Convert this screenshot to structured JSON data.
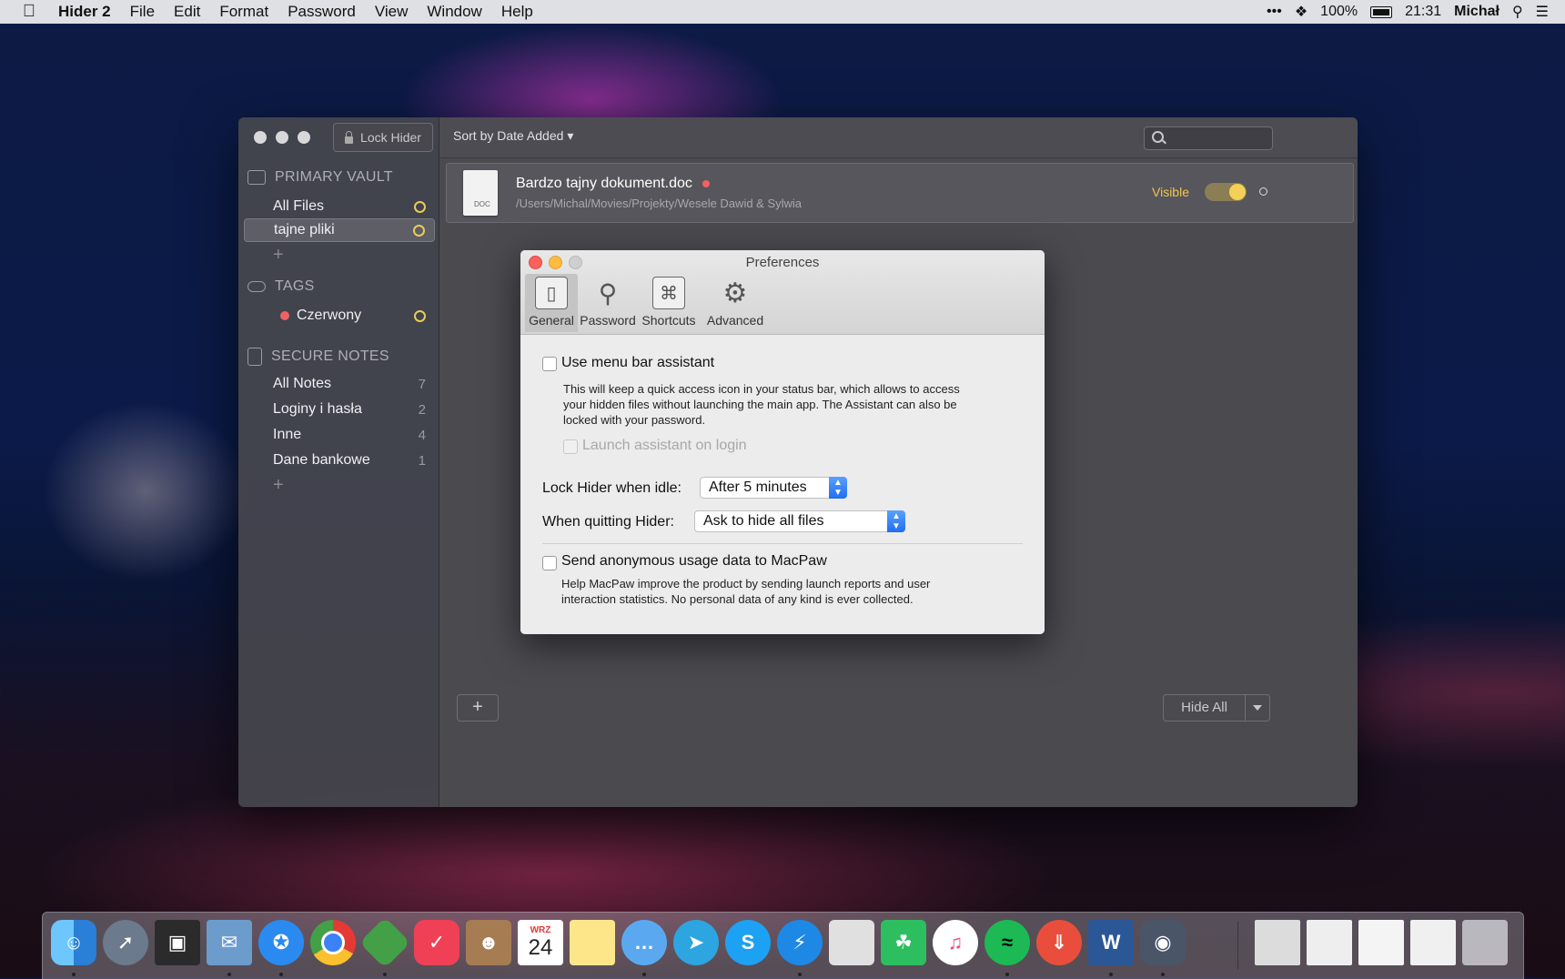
{
  "menubar": {
    "apple_icon": "apple-logo-icon",
    "app_name": "Hider 2",
    "menus": [
      "File",
      "Edit",
      "Format",
      "Password",
      "View",
      "Window",
      "Help"
    ],
    "battery": "100%",
    "time": "21:31",
    "user": "Michał"
  },
  "sidebar": {
    "lock_label": "Lock Hider",
    "primary_vault": {
      "title": "PRIMARY VAULT",
      "items": [
        {
          "label": "All Files"
        },
        {
          "label": "tajne pliki"
        }
      ]
    },
    "tags": {
      "title": "TAGS",
      "items": [
        {
          "label": "Czerwony",
          "color": "#f06262"
        }
      ]
    },
    "secure_notes": {
      "title": "SECURE NOTES",
      "items": [
        {
          "label": "All Notes",
          "count": "7"
        },
        {
          "label": "Loginy i hasła",
          "count": "2"
        },
        {
          "label": "Inne",
          "count": "4"
        },
        {
          "label": "Dane bankowe",
          "count": "1"
        }
      ]
    }
  },
  "toolbar": {
    "sort_label": "Sort by Date Added"
  },
  "file": {
    "name": "Bardzo tajny dokument.doc",
    "path": "/Users/Michal/Movies/Projekty/Wesele Dawid & Sylwia",
    "status": "Visible",
    "icon_label": "DOC"
  },
  "footer": {
    "add_label": "+",
    "hide_all_label": "Hide All"
  },
  "preferences": {
    "title": "Preferences",
    "tabs": [
      {
        "label": "General",
        "icon": "switch-icon"
      },
      {
        "label": "Password",
        "icon": "key-icon"
      },
      {
        "label": "Shortcuts",
        "icon": "command-icon"
      },
      {
        "label": "Advanced",
        "icon": "gear-icon"
      }
    ],
    "menu_bar_assistant": {
      "label": "Use menu bar assistant",
      "desc1": "This will keep a quick access icon in your status bar, which allows to access",
      "desc2": "your hidden files without launching the main app. The Assistant can also be",
      "desc3": "locked with your password.",
      "launch_label": "Launch assistant on login"
    },
    "lock_idle": {
      "label": "Lock Hider when idle:",
      "value": "After 5 minutes"
    },
    "quitting": {
      "label": "When quitting Hider:",
      "value": "Ask to hide all files"
    },
    "usage": {
      "label": "Send anonymous usage data to MacPaw",
      "desc1": "Help MacPaw improve the product by sending launch reports and user",
      "desc2": "interaction statistics. No personal data of any kind is ever collected."
    }
  },
  "dock": {
    "calendar_month": "WRZ",
    "calendar_day": "24"
  }
}
